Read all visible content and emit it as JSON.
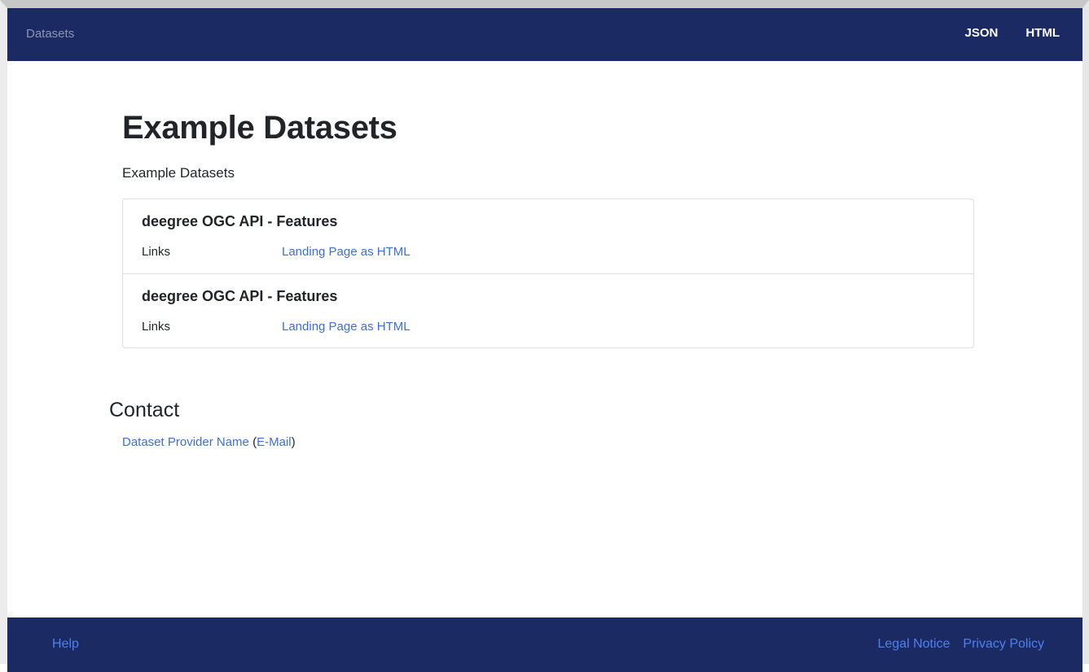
{
  "navbar": {
    "brand": "Datasets",
    "links": [
      "JSON",
      "HTML"
    ]
  },
  "main": {
    "title": "Example Datasets",
    "description": "Example Datasets",
    "datasets": [
      {
        "title": "deegree OGC API - Features",
        "links_label": "Links",
        "link_text": "Landing Page as HTML"
      },
      {
        "title": "deegree OGC API - Features",
        "links_label": "Links",
        "link_text": "Landing Page as HTML"
      }
    ]
  },
  "contact": {
    "heading": "Contact",
    "provider_name": "Dataset Provider Name",
    "open_paren": "(",
    "email_label": "E-Mail",
    "close_paren": ")"
  },
  "footer": {
    "help": "Help",
    "legal_notice": "Legal Notice",
    "privacy_policy": "Privacy Policy"
  },
  "colors": {
    "navbar_bg": "#1b2a63",
    "link": "#3b6fe0",
    "footer_link": "#4d80f0"
  }
}
